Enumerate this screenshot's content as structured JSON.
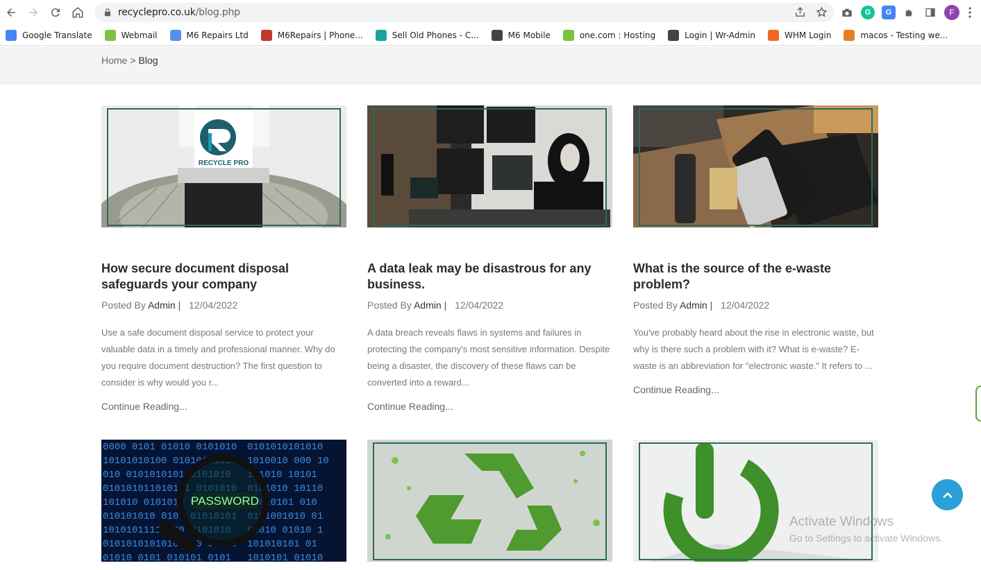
{
  "browser": {
    "url_host": "recyclepro.co.uk",
    "url_path": "/blog.php",
    "profile_initial": "F",
    "bookmarks": [
      {
        "label": "Google Translate",
        "color": "#4285f4"
      },
      {
        "label": "Webmail",
        "color": "#7cc242"
      },
      {
        "label": "M6 Repairs Ltd",
        "color": "#5b8def"
      },
      {
        "label": "M6Repairs | Phone...",
        "color": "#c0392b"
      },
      {
        "label": "Sell Old Phones - C...",
        "color": "#1aa39a"
      },
      {
        "label": "M6 Mobile",
        "color": "#444444"
      },
      {
        "label": "one.com : Hosting",
        "color": "#7cc242"
      },
      {
        "label": "Login | Wr-Admin",
        "color": "#444444"
      },
      {
        "label": "WHM Login",
        "color": "#f26522"
      },
      {
        "label": "macos - Testing we...",
        "color": "#e67e22"
      }
    ]
  },
  "breadcrumb": {
    "home": "Home",
    "separator": ">",
    "current": "Blog"
  },
  "posts": [
    {
      "title": "How secure document disposal safeguards your company",
      "posted_by": "Posted By",
      "author": "Admin",
      "date": "12/04/2022",
      "excerpt": "Use a safe document disposal service to protect your valuable data in a timely and professional manner. Why do you require document destruction? The first question to consider is why would you r...",
      "more": "Continue Reading...",
      "image": "shredded-paper-recycle-pro"
    },
    {
      "title": "A data leak may be disastrous for any business.",
      "posted_by": "Posted By",
      "author": "Admin",
      "date": "12/04/2022",
      "excerpt": "A data breach reveals flaws in systems and failures in protecting the company's most sensitive information. Despite being a disaster, the discovery of these flaws can be converted into a reward...",
      "more": "Continue Reading...",
      "image": "hacker-monitors"
    },
    {
      "title": "What is the source of the e-waste problem?",
      "posted_by": "Posted By",
      "author": "Admin",
      "date": "12/04/2022",
      "excerpt": "You've probably heard about the rise in electronic waste, but why is there such a problem with it? What is e-waste? E-waste is an abbreviation for \"electronic waste.\" It refers to ...",
      "more": "Continue Reading...",
      "image": "e-waste-phones"
    },
    {
      "image": "binary-password",
      "image_text": "PASSWORD"
    },
    {
      "image": "green-recycle-symbol"
    },
    {
      "image": "green-power-symbol"
    }
  ],
  "logo_text": "RECYCLE PRO",
  "watermark": {
    "line1": "Activate Windows",
    "line2": "Go to Settings to activate Windows."
  }
}
